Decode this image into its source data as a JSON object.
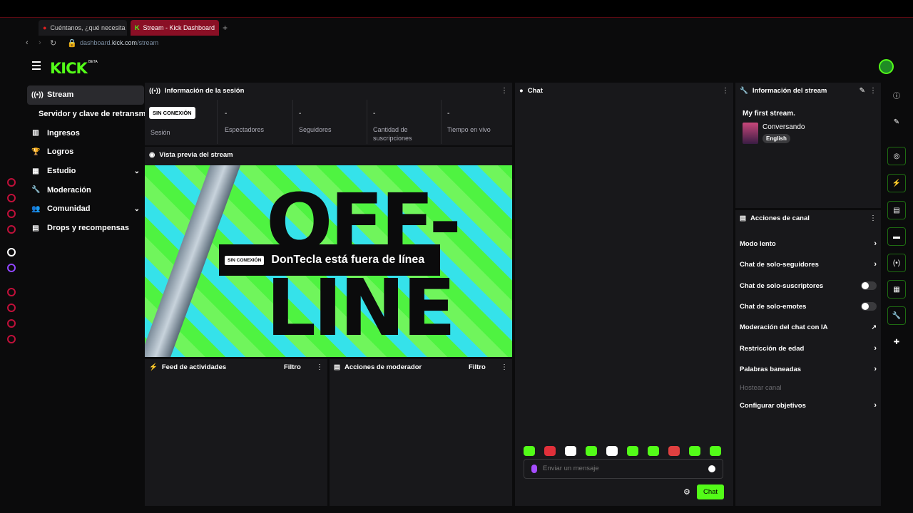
{
  "browser": {
    "tab1_title": "Cuéntanos, ¿qué necesita",
    "tab2_title": "Stream - Kick Dashboard",
    "url_prefix": "dashboard.",
    "url_domain": "kick.com",
    "url_path": "/stream"
  },
  "app": {
    "logo": "KICK",
    "logo_badge": "BETA"
  },
  "sidebar": {
    "items": [
      {
        "label": "Stream",
        "icon": "broadcast-icon"
      },
      {
        "label": "Servidor y clave de retransm",
        "icon": ""
      },
      {
        "label": "Ingresos",
        "icon": "chart-icon"
      },
      {
        "label": "Logros",
        "icon": "trophy-icon"
      },
      {
        "label": "Estudio",
        "icon": "studio-icon"
      },
      {
        "label": "Moderación",
        "icon": "wrench-icon"
      },
      {
        "label": "Comunidad",
        "icon": "people-icon"
      },
      {
        "label": "Drops y recompensas",
        "icon": "gift-icon"
      }
    ]
  },
  "session": {
    "title": "Información de la sesión",
    "status_badge": "SIN CONEXIÓN",
    "stats": [
      {
        "value": "",
        "label": "Sesión"
      },
      {
        "value": "-",
        "label": "Espectadores"
      },
      {
        "value": "-",
        "label": "Seguidores"
      },
      {
        "value": "-",
        "label": "Cantidad de suscripciones"
      },
      {
        "value": "-",
        "label": "Tiempo en vivo"
      }
    ]
  },
  "preview": {
    "title": "Vista previa del stream",
    "offline_badge": "SIN CONEXIÓN",
    "offline_text": "DonTecla está fuera de línea",
    "big_letters": "OFF-\nLINE"
  },
  "activity": {
    "title": "Feed de actividades",
    "filter": "Filtro"
  },
  "modactions": {
    "title": "Acciones de moderador",
    "filter": "Filtro"
  },
  "chat": {
    "title": "Chat",
    "placeholder": "Enviar un mensaje",
    "send_label": "Chat",
    "emote_count": 10
  },
  "streaminfo": {
    "title": "Información del stream",
    "stream_title": "My first stream.",
    "category": "Conversando",
    "language": "English"
  },
  "channel_actions": {
    "title": "Acciones de canal",
    "items": [
      {
        "label": "Modo lento",
        "control": "arrow"
      },
      {
        "label": "Chat de solo-seguidores",
        "control": "arrow"
      },
      {
        "label": "Chat de solo-suscriptores",
        "control": "toggle"
      },
      {
        "label": "Chat de solo-emotes",
        "control": "toggle"
      },
      {
        "label": "Moderación del chat con IA",
        "control": "external"
      },
      {
        "label": "Restricción de edad",
        "control": "arrow"
      },
      {
        "label": "Palabras baneadas",
        "control": "arrow"
      },
      {
        "label": "Hostear canal",
        "control": "disabled"
      },
      {
        "label": "Configurar objetivos",
        "control": "arrow"
      }
    ]
  },
  "colors": {
    "accent": "#53fc18",
    "panel": "#18181b",
    "background": "#0b0b0c",
    "browser_accent": "#8a0f25"
  }
}
